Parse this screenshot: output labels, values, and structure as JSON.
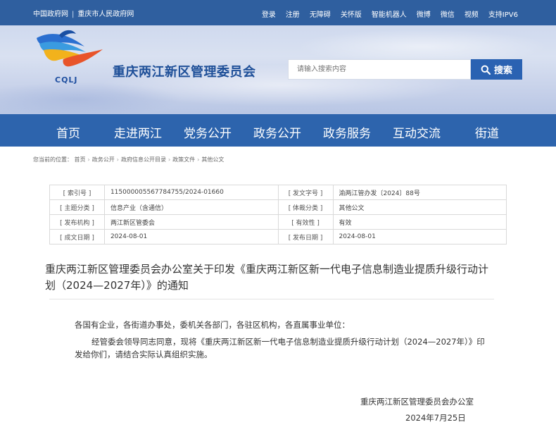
{
  "topbar": {
    "link_gov": "中国政府网",
    "link_cq": "重庆市人民政府网",
    "items": [
      "登录",
      "注册",
      "无障碍",
      "关怀版",
      "智能机器人",
      "微博",
      "微信",
      "视频",
      "支持IPV6"
    ]
  },
  "header": {
    "logo_text": "CQLJ",
    "site_title": "重庆两江新区管理委员会",
    "search_placeholder": "请输入搜索内容",
    "search_button": "搜索"
  },
  "nav": [
    "首页",
    "走进两江",
    "党务公开",
    "政务公开",
    "政务服务",
    "互动交流",
    "街道"
  ],
  "breadcrumb": {
    "label": "您当前的位置：",
    "items": [
      "首页",
      "政务公开",
      "政府信息公开目录",
      "政策文件",
      "其他公文"
    ]
  },
  "info": {
    "rows": [
      {
        "k1": "[ 索引号 ]",
        "v1": "115000005567784755/2024-01660",
        "k2": "[ 发文字号 ]",
        "v2": "渝两江管办发〔2024〕88号"
      },
      {
        "k1": "[ 主题分类 ]",
        "v1": "信息产业（含通信）",
        "k2": "[ 体裁分类 ]",
        "v2": "其他公文"
      },
      {
        "k1": "[ 发布机构 ]",
        "v1": "两江新区管委会",
        "k2": "[ 有效性 ]",
        "v2": "有效"
      },
      {
        "k1": "[ 成文日期 ]",
        "v1": "2024-08-01",
        "k2": "[ 发布日期 ]",
        "v2": "2024-08-01"
      }
    ]
  },
  "document": {
    "title": "重庆两江新区管理委员会办公室关于印发《重庆两江新区新一代电子信息制造业提质升级行动计划（2024—2027年）》的通知",
    "salutation": "各国有企业，各街道办事处，委机关各部门，各驻区机构，各直属事业单位：",
    "paragraph": "经管委会领导同志同意，现将《重庆两江新区新一代电子信息制造业提质升级行动计划（2024—2027年）》印发给你们，请结合实际认真组织实施。",
    "signature_org": "重庆两江新区管理委员会办公室",
    "signature_date": "2024年7月25日"
  },
  "colors": {
    "topbar": "#2f5f9f",
    "nav": "#2d64ad",
    "search_button": "#2a62b2",
    "title_blue": "#1e4f98"
  }
}
